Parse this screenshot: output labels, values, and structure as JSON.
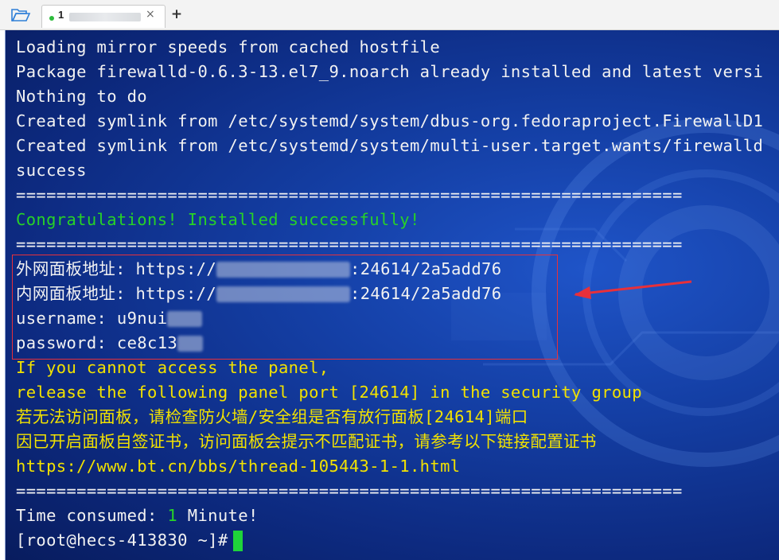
{
  "tabbar": {
    "tab_title": "1",
    "tab_close": "×",
    "new_tab": "+"
  },
  "terminal": {
    "lines": [
      "Loading mirror speeds from cached hostfile",
      "Package firewalld-0.6.3-13.el7_9.noarch already installed and latest versi",
      "Nothing to do",
      "Created symlink from /etc/systemd/system/dbus-org.fedoraproject.FirewallD1",
      "Created symlink from /etc/systemd/system/multi-user.target.wants/firewalld",
      "success",
      "==================================================================",
      "Congratulations! Installed successfully!",
      "=================================================================="
    ],
    "outer_panel_label": "外网面板地址: https://",
    "outer_panel_suffix": ":24614/2a5add76",
    "inner_panel_label": "内网面板地址: https://",
    "inner_panel_suffix": ":24614/2a5add76",
    "username_label": "username: u9nui",
    "password_label": "password: ce8c13",
    "notes": [
      "If you cannot access the panel,",
      "release the following panel port [24614] in the security group",
      "若无法访问面板，请检查防火墙/安全组是否有放行面板[24614]端口",
      "因已开启面板自签证书，访问面板会提示不匹配证书，请参考以下链接配置证书",
      "https://www.bt.cn/bbs/thread-105443-1-1.html"
    ],
    "separator_end": "==================================================================",
    "time_label": "Time consumed: ",
    "time_value": "1",
    "time_unit": " Minute!",
    "prompt": "[root@hecs-413830 ~]#"
  },
  "colors": {
    "green": "#27d227",
    "yellow": "#f2e200",
    "highlight": "#e8303a",
    "cursor": "#1fd43a"
  }
}
